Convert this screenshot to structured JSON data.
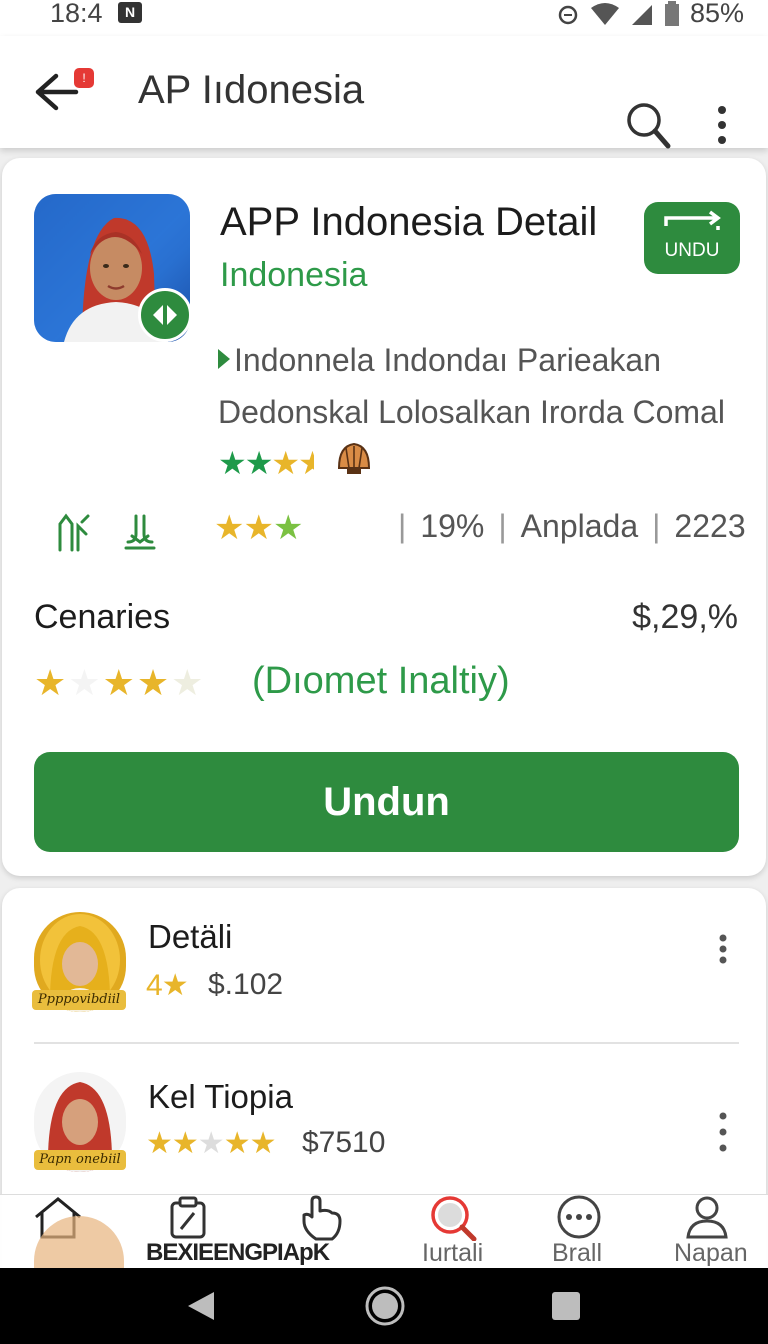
{
  "status_bar": {
    "time": "18:4",
    "notification_badge": "N",
    "battery": "85%"
  },
  "app_bar": {
    "back_badge": "!",
    "title": "AP Iıdonesia"
  },
  "app": {
    "title": "APP Indonesia Detail",
    "developer": "Indonesia",
    "action_label": "UNDU",
    "description_line1": "Indonnela Indondaı Parieakan",
    "description_line2": "Dedonskal Lolosalkan Irorda Comal",
    "stats": {
      "percent": "19%",
      "label": "Anplada",
      "count": "2223"
    },
    "category_label": "Cenaries",
    "price": "$,29,%",
    "rating_note": "(Dıomet Inaltiy)",
    "install_label": "Undun"
  },
  "list_items": [
    {
      "title": "Detäli",
      "rating_prefix": "4",
      "price": "$.102",
      "ribbon": "Ppppovibdiil"
    },
    {
      "title": "Kel Tiopia",
      "price": "$7510",
      "ribbon": "Papn onebiil"
    }
  ],
  "bottom_nav": [
    {
      "label": "",
      "icon": "home-icon"
    },
    {
      "label": "BEXIEENGPIApK",
      "icon": "clipboard-icon"
    },
    {
      "label": "",
      "icon": "hand-icon"
    },
    {
      "label": "Iurtali",
      "icon": "search-icon"
    },
    {
      "label": "Brall",
      "icon": "more-circle-icon"
    },
    {
      "label": "Napan",
      "icon": "person-icon"
    }
  ],
  "colors": {
    "accent": "#2e8b3e",
    "accent_text": "#2e9a49",
    "star": "#e8b52a",
    "star_green": "#1e9a4a"
  }
}
